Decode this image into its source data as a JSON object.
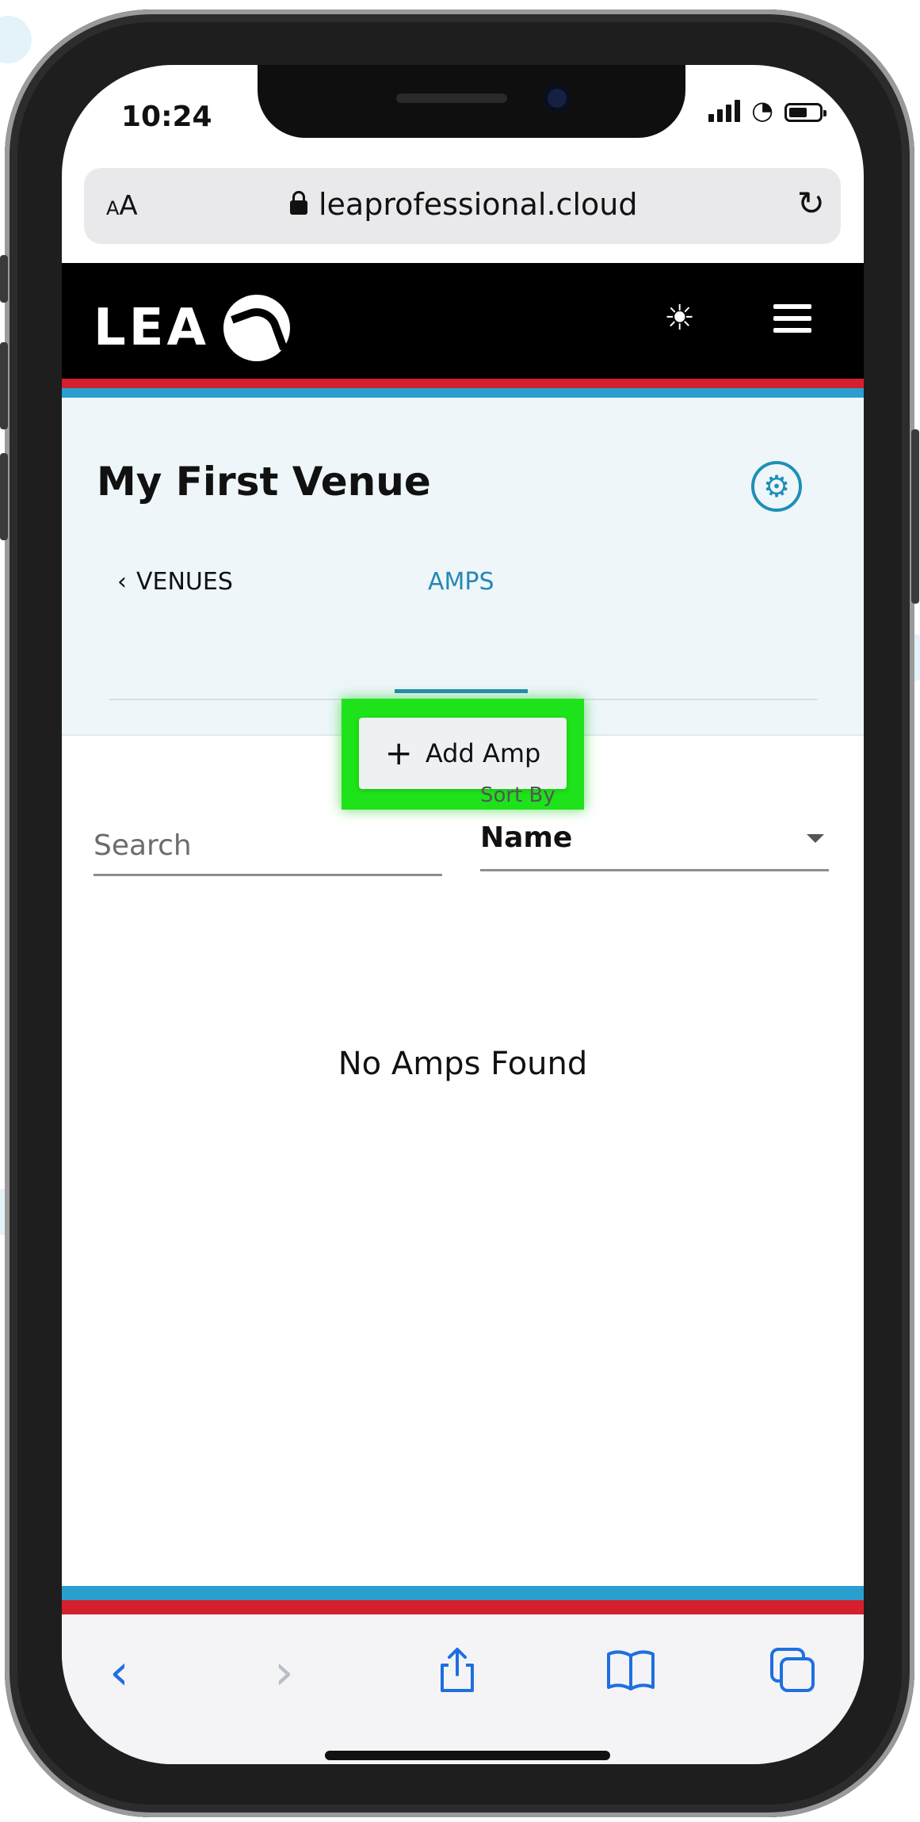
{
  "status_bar": {
    "time": "10:24"
  },
  "browser": {
    "text_size_label": "AA",
    "url": "leaprofessional.cloud"
  },
  "header": {
    "brand": "LEA"
  },
  "venue": {
    "title": "My First Venue",
    "tabs": {
      "back_label": "VENUES",
      "active_label": "AMPS"
    },
    "add_button_label": "Add Amp"
  },
  "filters": {
    "search_placeholder": "Search",
    "sort_caption": "Sort By",
    "sort_value": "Name"
  },
  "list": {
    "empty_message": "No Amps Found"
  },
  "colors": {
    "brand_red": "#d4202e",
    "brand_blue": "#2a9fcf",
    "accent": "#2788b4",
    "highlight": "#1ee21a"
  }
}
